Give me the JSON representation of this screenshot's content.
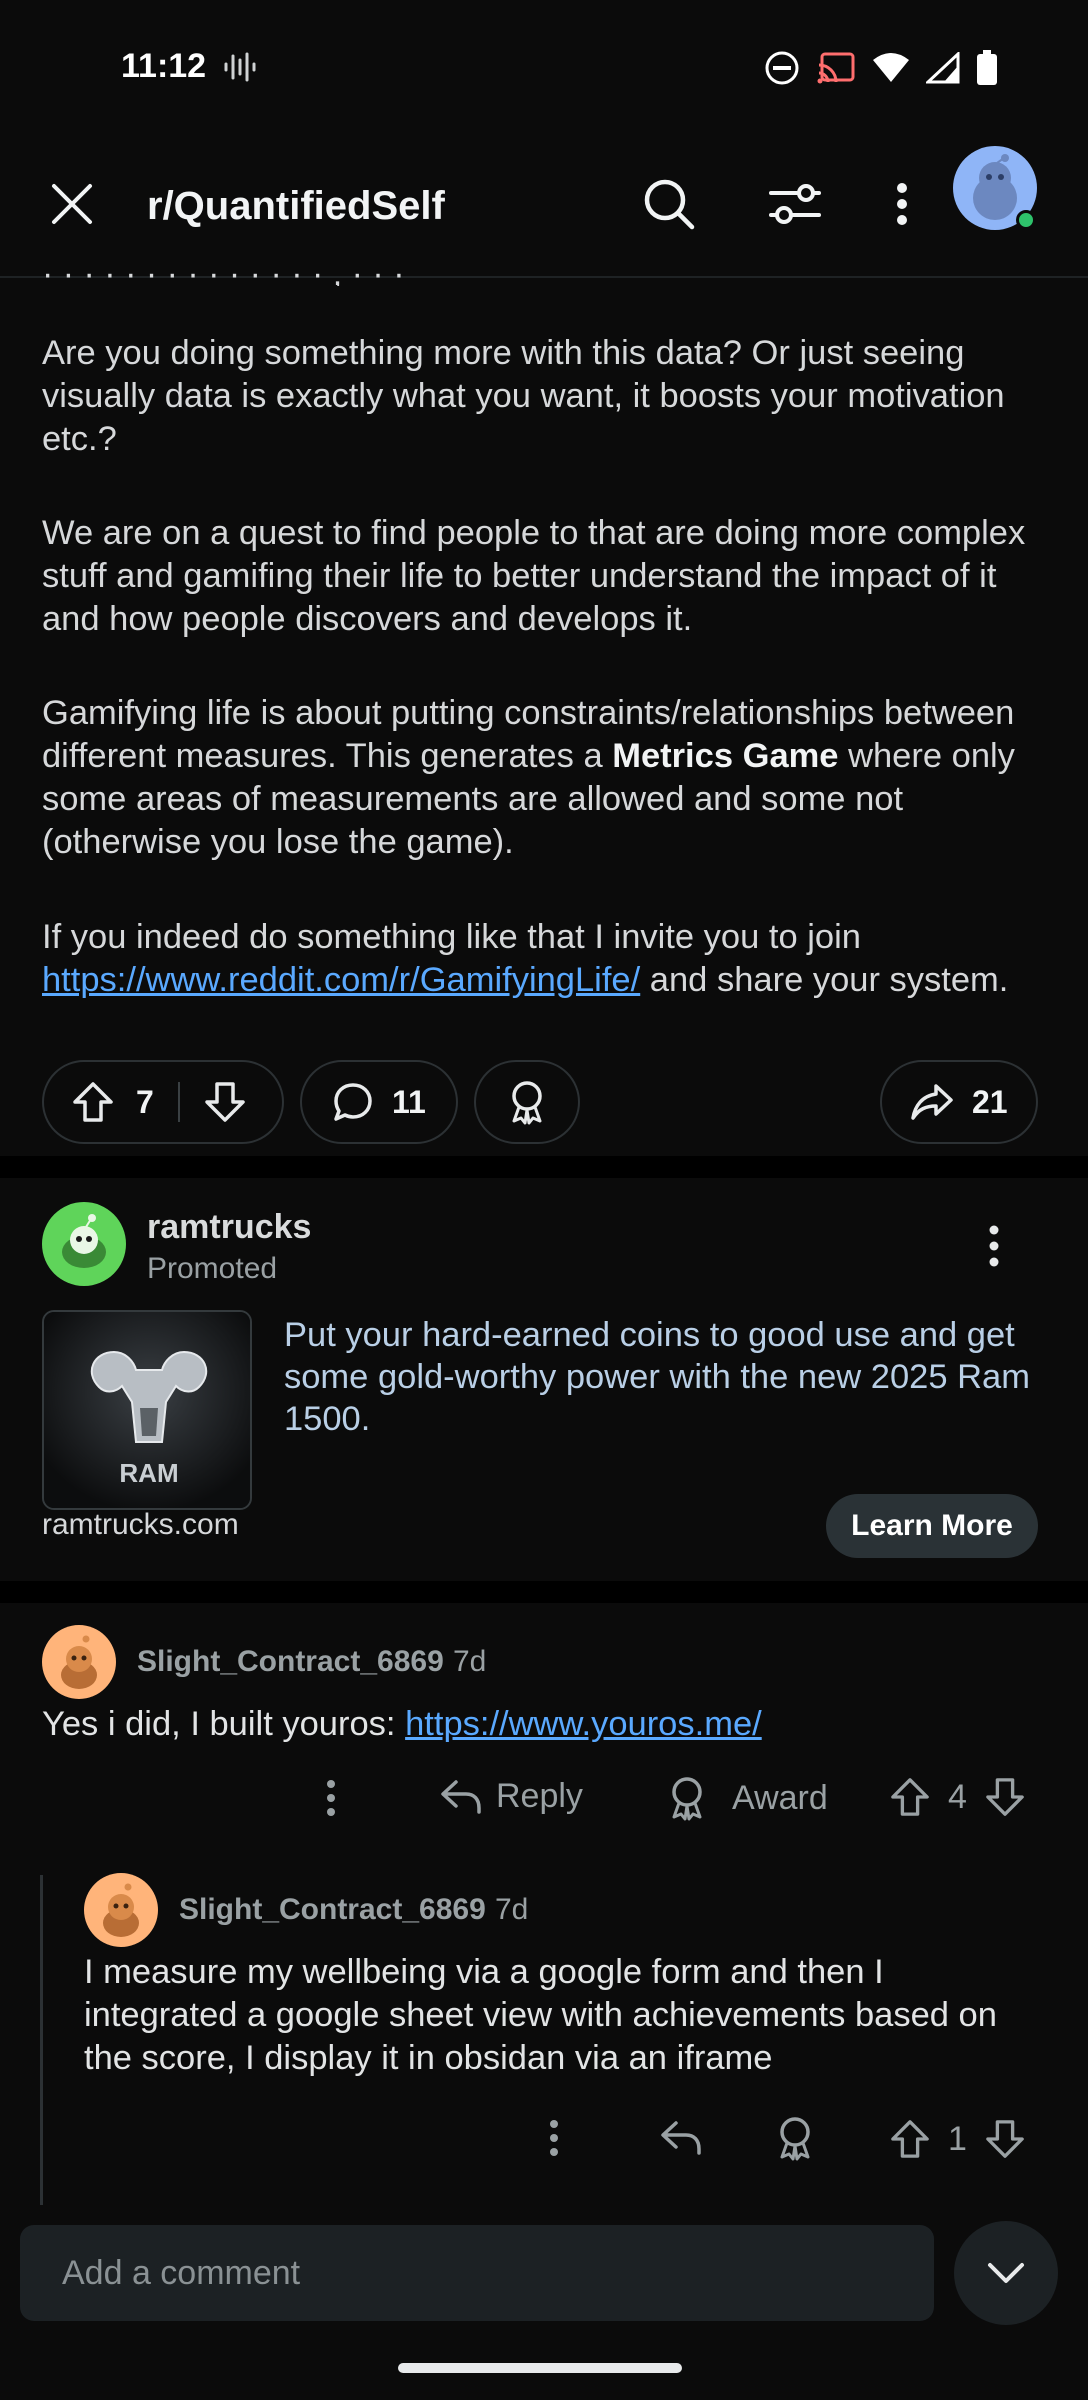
{
  "status_bar": {
    "time": "11:12"
  },
  "header": {
    "subreddit": "r/QuantifiedSelf"
  },
  "post": {
    "cut_line": "· · · · · · · · · ·  · · · · ,  · · ·",
    "paragraphs": [
      "Are you doing something more with this data? Or just seeing visually data is exactly what you want, it boosts your motivation etc.?",
      "We are on a quest to find people to that are doing more complex stuff and gamifing their life to better understand the impact of it and how people discovers and develops it.",
      {
        "before": "Gamifying life is about putting constraints/relationships between different measures. This generates a ",
        "bold": "Metrics Game",
        "after": " where only some areas of measurements are allowed and some not (otherwise you lose the game)."
      },
      {
        "before": "If you indeed do something like that I invite you to join ",
        "link": "https://www.reddit.com/r/GamifyingLife/",
        "after": " and share your system."
      }
    ],
    "votes": "7",
    "comments": "11",
    "shares": "21"
  },
  "ad": {
    "advertiser": "ramtrucks",
    "promoted_label": "Promoted",
    "thumb_brand": "RAM",
    "text": "Put your hard-earned coins to good use and get some gold-worthy power with the new 2025 Ram 1500.",
    "domain": "ramtrucks.com",
    "cta": "Learn More"
  },
  "comments": [
    {
      "user": "Slight_Contract_6869",
      "age": "7d",
      "text_before": "Yes i did, I built youros: ",
      "link": "https://www.youros.me/",
      "reply_label": "Reply",
      "award_label": "Award",
      "score": "4"
    },
    {
      "user": "Slight_Contract_6869",
      "age": "7d",
      "text": "I measure my wellbeing via a google form and then I integrated a google sheet view with achievements based on the score, I display it in obsidan via an iframe",
      "score": "1"
    }
  ],
  "composer": {
    "placeholder": "Add a comment"
  },
  "colors": {
    "link": "#5aa9ff",
    "online": "#2ec26b",
    "background": "#0b0b0b"
  },
  "icons": [
    "close-icon",
    "search-icon",
    "filter-icon",
    "more-vert-icon",
    "upvote-icon",
    "downvote-icon",
    "comment-icon",
    "award-icon",
    "share-icon",
    "reply-icon",
    "chevron-down-icon"
  ]
}
